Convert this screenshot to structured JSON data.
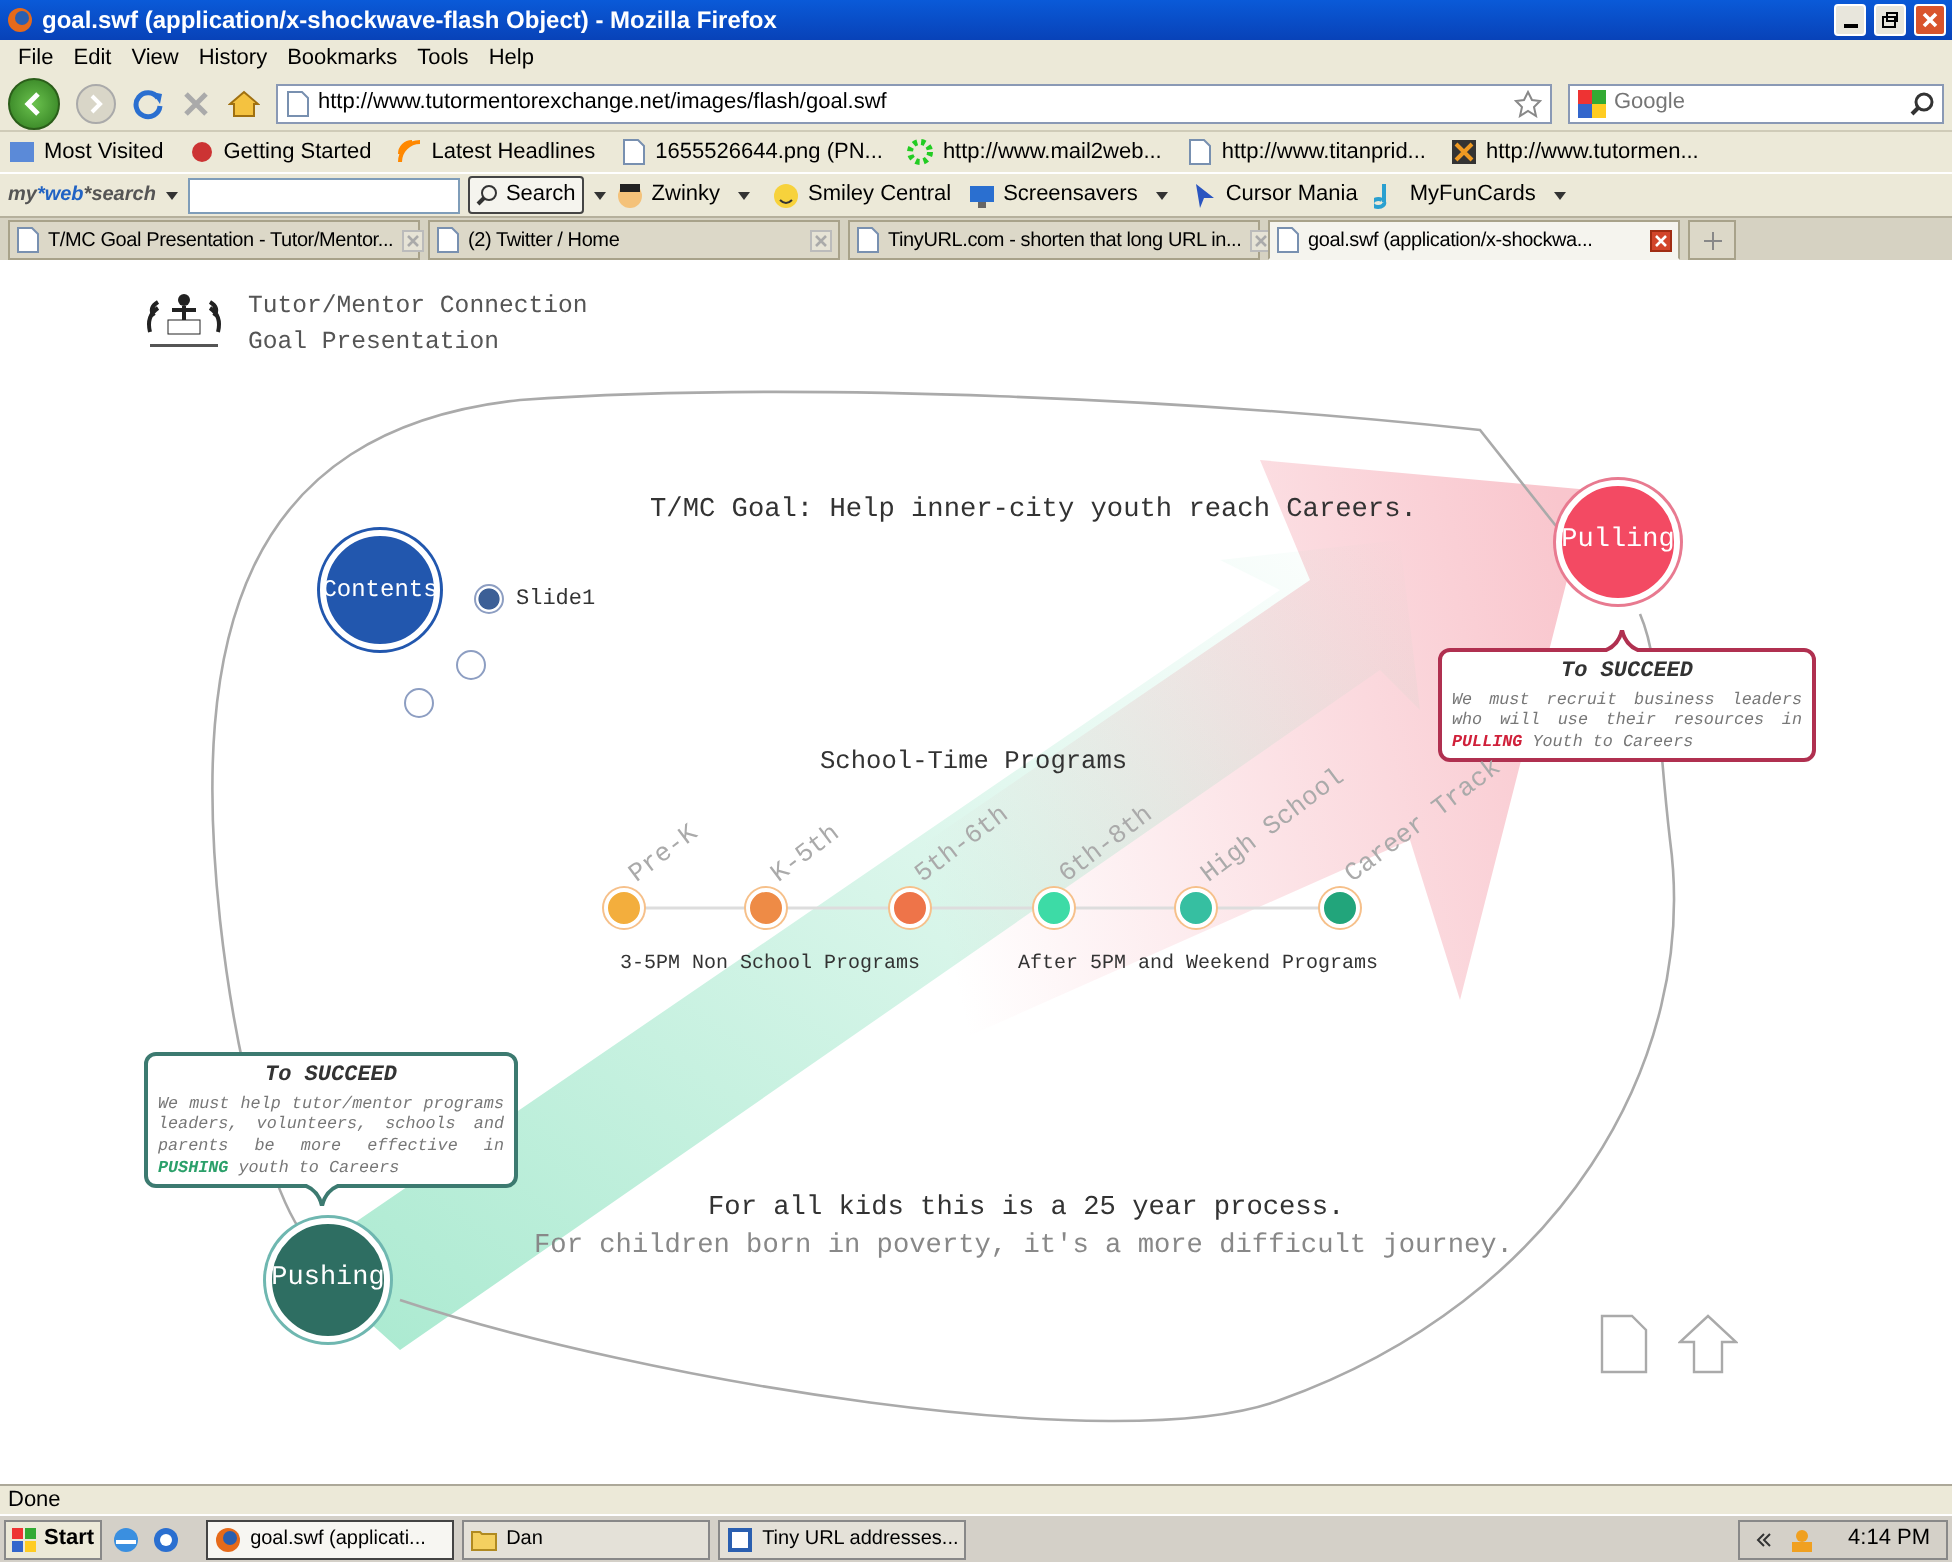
{
  "window": {
    "title": "goal.swf (application/x-shockwave-flash Object) - Mozilla Firefox"
  },
  "menu": [
    "File",
    "Edit",
    "View",
    "History",
    "Bookmarks",
    "Tools",
    "Help"
  ],
  "navigation": {
    "url": "http://www.tutormentorexchange.net/images/flash/goal.swf",
    "search_placeholder": "Google"
  },
  "bookmarks": [
    "Most Visited",
    "Getting Started",
    "Latest Headlines",
    "1655526644.png (PN...",
    "http://www.mail2web...",
    "http://www.titanprid...",
    "http://www.tutormen..."
  ],
  "search_toolbar": {
    "logo": "my***web***search",
    "button": "Search",
    "items": [
      "Zwinky",
      "Smiley Central",
      "Screensavers",
      "Cursor Mania",
      "MyFunCards"
    ]
  },
  "tabs": [
    {
      "label": "T/MC Goal Presentation - Tutor/Mentor...",
      "selected": false
    },
    {
      "label": "(2) Twitter / Home",
      "selected": false
    },
    {
      "label": "TinyURL.com - shorten that long URL in...",
      "selected": false
    },
    {
      "label": "goal.swf (application/x-shockwa...",
      "selected": true
    }
  ],
  "presentation": {
    "header": [
      "Tutor/Mentor Connection",
      "Goal Presentation"
    ],
    "goal": "T/MC Goal: Help inner-city youth reach Careers.",
    "contents": "Contents",
    "slides": [
      {
        "label": "Slide1",
        "selected": true
      },
      {
        "selected": false
      },
      {
        "selected": false
      }
    ],
    "pulling": {
      "label": "Pulling",
      "callout_title": "To SUCCEED",
      "callout_body": "We must recruit business leaders who will use their resources in **PULLING** Youth to Careers"
    },
    "pushing": {
      "label": "Pushing",
      "callout_title": "To SUCCEED",
      "callout_body": "We must help tutor/mentor programs leaders, volunteers, schools and parents be more effective in **PUSHING** youth to Careers"
    },
    "timeline": {
      "title": "School-Time Programs",
      "stages": [
        {
          "label": "Pre-K",
          "color": "#f3ae3d"
        },
        {
          "label": "K-5th",
          "color": "#ee8b46"
        },
        {
          "label": "5th-6th",
          "color": "#ee7449"
        },
        {
          "label": "6th-8th",
          "color": "#3ddba6"
        },
        {
          "label": "High School",
          "color": "#36bfa1"
        },
        {
          "label": "Career Track",
          "color": "#22a57b"
        }
      ],
      "groups": [
        "3-5PM Non School Programs",
        "After 5PM and Weekend Programs"
      ]
    },
    "footer": [
      "For all kids this is a 25 year process.",
      "For children born in poverty, it's a more difficult journey."
    ]
  },
  "status_bar": "Done",
  "taskbar": {
    "start": "Start",
    "tasks": [
      {
        "label": "goal.swf (applicati...",
        "selected": true
      },
      {
        "label": "Dan",
        "selected": false
      },
      {
        "label": "Tiny URL addresses...",
        "selected": false
      }
    ],
    "clock": "4:14 PM"
  }
}
